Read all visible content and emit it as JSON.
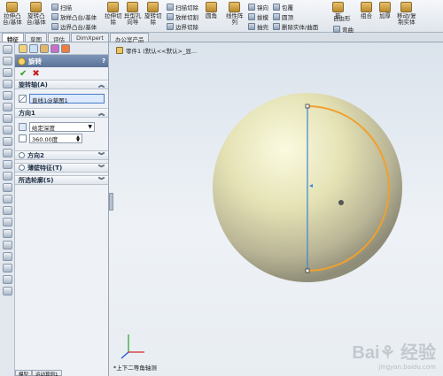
{
  "ribbon": {
    "buttons": [
      {
        "label": "拉伸凸\n台/基体",
        "icon": "extrude-boss-icon"
      },
      {
        "label": "旋转凸\n台/基体",
        "icon": "revolve-boss-icon"
      },
      {
        "label": "拉伸切\n除",
        "icon": "extrude-cut-icon"
      },
      {
        "label": "异型孔\n向导",
        "icon": "hole-wizard-icon"
      },
      {
        "label": "旋转切\n除",
        "icon": "revolve-cut-icon"
      },
      {
        "label": "圆角",
        "icon": "fillet-icon"
      },
      {
        "label": "线性阵\n列",
        "icon": "linear-pattern-icon"
      },
      {
        "label": "筋",
        "icon": "rib-icon"
      },
      {
        "label": "自由形",
        "icon": "freeform-icon"
      },
      {
        "label": "组合",
        "icon": "combine-icon"
      },
      {
        "label": "加厚",
        "icon": "thicken-icon"
      },
      {
        "label": "移动/复\n制实体",
        "icon": "move-copy-icon"
      }
    ],
    "small": [
      {
        "label": "扫描",
        "icon": "sweep-icon"
      },
      {
        "label": "放样凸台/基体",
        "icon": "loft-icon"
      },
      {
        "label": "边界凸台/基体",
        "icon": "boundary-icon"
      },
      {
        "label": "扫描切除",
        "icon": "sweep-cut-icon"
      },
      {
        "label": "放样切割",
        "icon": "loft-cut-icon"
      },
      {
        "label": "边界切除",
        "icon": "boundary-cut-icon"
      },
      {
        "label": "拔模",
        "icon": "draft-icon"
      },
      {
        "label": "抽壳",
        "icon": "shell-icon"
      },
      {
        "label": "包覆",
        "icon": "wrap-icon"
      },
      {
        "label": "圆顶",
        "icon": "dome-icon"
      },
      {
        "label": "镜向",
        "icon": "mirror-icon"
      },
      {
        "label": "删除实体/曲面",
        "icon": "delete-body-icon"
      },
      {
        "label": "弯曲",
        "icon": "flex-icon"
      }
    ]
  },
  "tabs": [
    "特征",
    "草图",
    "评估",
    "DimXpert",
    "办公室产品"
  ],
  "pm": {
    "title": "旋转",
    "help": "?",
    "ok": "✔",
    "cancel": "✖",
    "axis_header": "旋转轴(A)",
    "axis_value": "直线1@草图1",
    "dir1_header": "方向1",
    "end_condition": "给定深度",
    "angle": "360.00度",
    "dir2_header": "方向2",
    "thin_header": "薄壁特征(T)",
    "contours_header": "所选轮廓(S)"
  },
  "viewport": {
    "breadcrumb": "零件1 (默认<<默认>_显...",
    "view_label": "*上下二等角轴测",
    "watermark_brand": "Bai⚘ 经验",
    "watermark_url": "jingyan.baidu.com"
  },
  "status_tabs": [
    "模型",
    "运动算例1"
  ],
  "colors": {
    "sphere_light": "#f7f5d2",
    "sphere_dark": "#8b8a6d",
    "axis_line": "#3a86d6",
    "profile_arc": "#f0a030",
    "title_bar": "#6a83a8"
  }
}
